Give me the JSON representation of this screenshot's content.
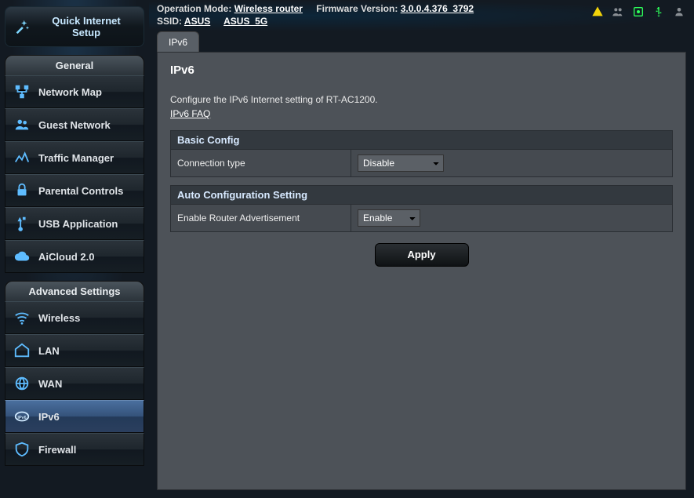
{
  "qis_label": "Quick Internet\nSetup",
  "header": {
    "op_mode_label": "Operation Mode:",
    "op_mode_value": "Wireless router",
    "fw_label": "Firmware Version:",
    "fw_value": "3.0.0.4.376_3792",
    "ssid_label": "SSID:",
    "ssid1": "ASUS",
    "ssid2": "ASUS_5G"
  },
  "general_cap": "General",
  "general": [
    {
      "label": "Network Map"
    },
    {
      "label": "Guest Network"
    },
    {
      "label": "Traffic Manager"
    },
    {
      "label": "Parental Controls"
    },
    {
      "label": "USB Application"
    },
    {
      "label": "AiCloud 2.0"
    }
  ],
  "advanced_cap": "Advanced Settings",
  "advanced": [
    {
      "label": "Wireless"
    },
    {
      "label": "LAN"
    },
    {
      "label": "WAN"
    },
    {
      "label": "IPv6"
    },
    {
      "label": "Firewall"
    }
  ],
  "tab_label": "IPv6",
  "page": {
    "title": "IPv6",
    "desc": "Configure the IPv6 Internet setting of RT-AC1200.",
    "faq": "IPv6 FAQ",
    "section1": "Basic Config",
    "row1_label": "Connection type",
    "row1_value": "Disable",
    "section2": "Auto Configuration Setting",
    "row2_label": "Enable Router Advertisement",
    "row2_value": "Enable",
    "apply": "Apply"
  }
}
